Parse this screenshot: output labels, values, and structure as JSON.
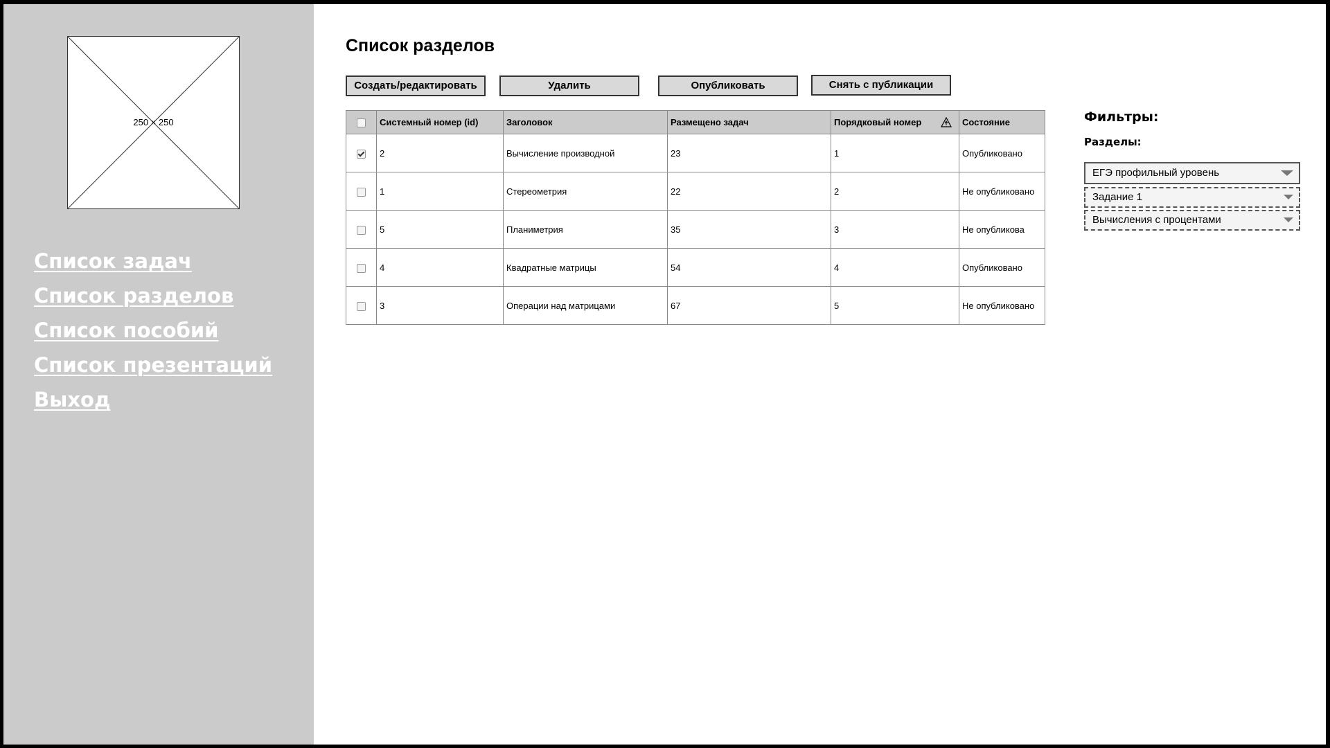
{
  "sidebar": {
    "logo_label": "250 × 250",
    "nav": [
      {
        "label": "Список задач"
      },
      {
        "label": "Список разделов"
      },
      {
        "label": "Список пособий"
      },
      {
        "label": "Список презентаций"
      },
      {
        "label": "Выход"
      }
    ]
  },
  "main": {
    "title": "Список разделов",
    "buttons": {
      "create": "Создать/редактировать",
      "delete": "Удалить",
      "publish": "Опубликовать",
      "unpublish": "Снять с публикации"
    },
    "table": {
      "headers": [
        "Системный номер (id)",
        "Заголовок",
        "Размещено задач",
        "Порядковый номер",
        "Состояние"
      ],
      "rows": [
        {
          "checked": true,
          "id": "2",
          "title": "Вычисление производной",
          "tasks": "23",
          "order": "1",
          "status": "Опубликовано"
        },
        {
          "checked": false,
          "id": "1",
          "title": "Стереометрия",
          "tasks": "22",
          "order": "2",
          "status": "Не опубликовано"
        },
        {
          "checked": false,
          "id": "5",
          "title": "Планиметрия",
          "tasks": "35",
          "order": "3",
          "status": "Не опубликова"
        },
        {
          "checked": false,
          "id": "4",
          "title": "Квадратные матрицы",
          "tasks": "54",
          "order": "4",
          "status": "Опубликовано"
        },
        {
          "checked": false,
          "id": "3",
          "title": "Операции над матрицами",
          "tasks": "67",
          "order": "5",
          "status": "Не опубликовано"
        }
      ]
    }
  },
  "filters": {
    "title": "Фильтры:",
    "sections_label": "Разделы:",
    "selects": [
      {
        "value": "ЕГЭ профильный уровень"
      },
      {
        "value": "Задание 1"
      },
      {
        "value": "Вычисления с процентами"
      }
    ]
  },
  "icons": {
    "sort": "sort-icon",
    "dropdown": "chevron-down-icon"
  }
}
